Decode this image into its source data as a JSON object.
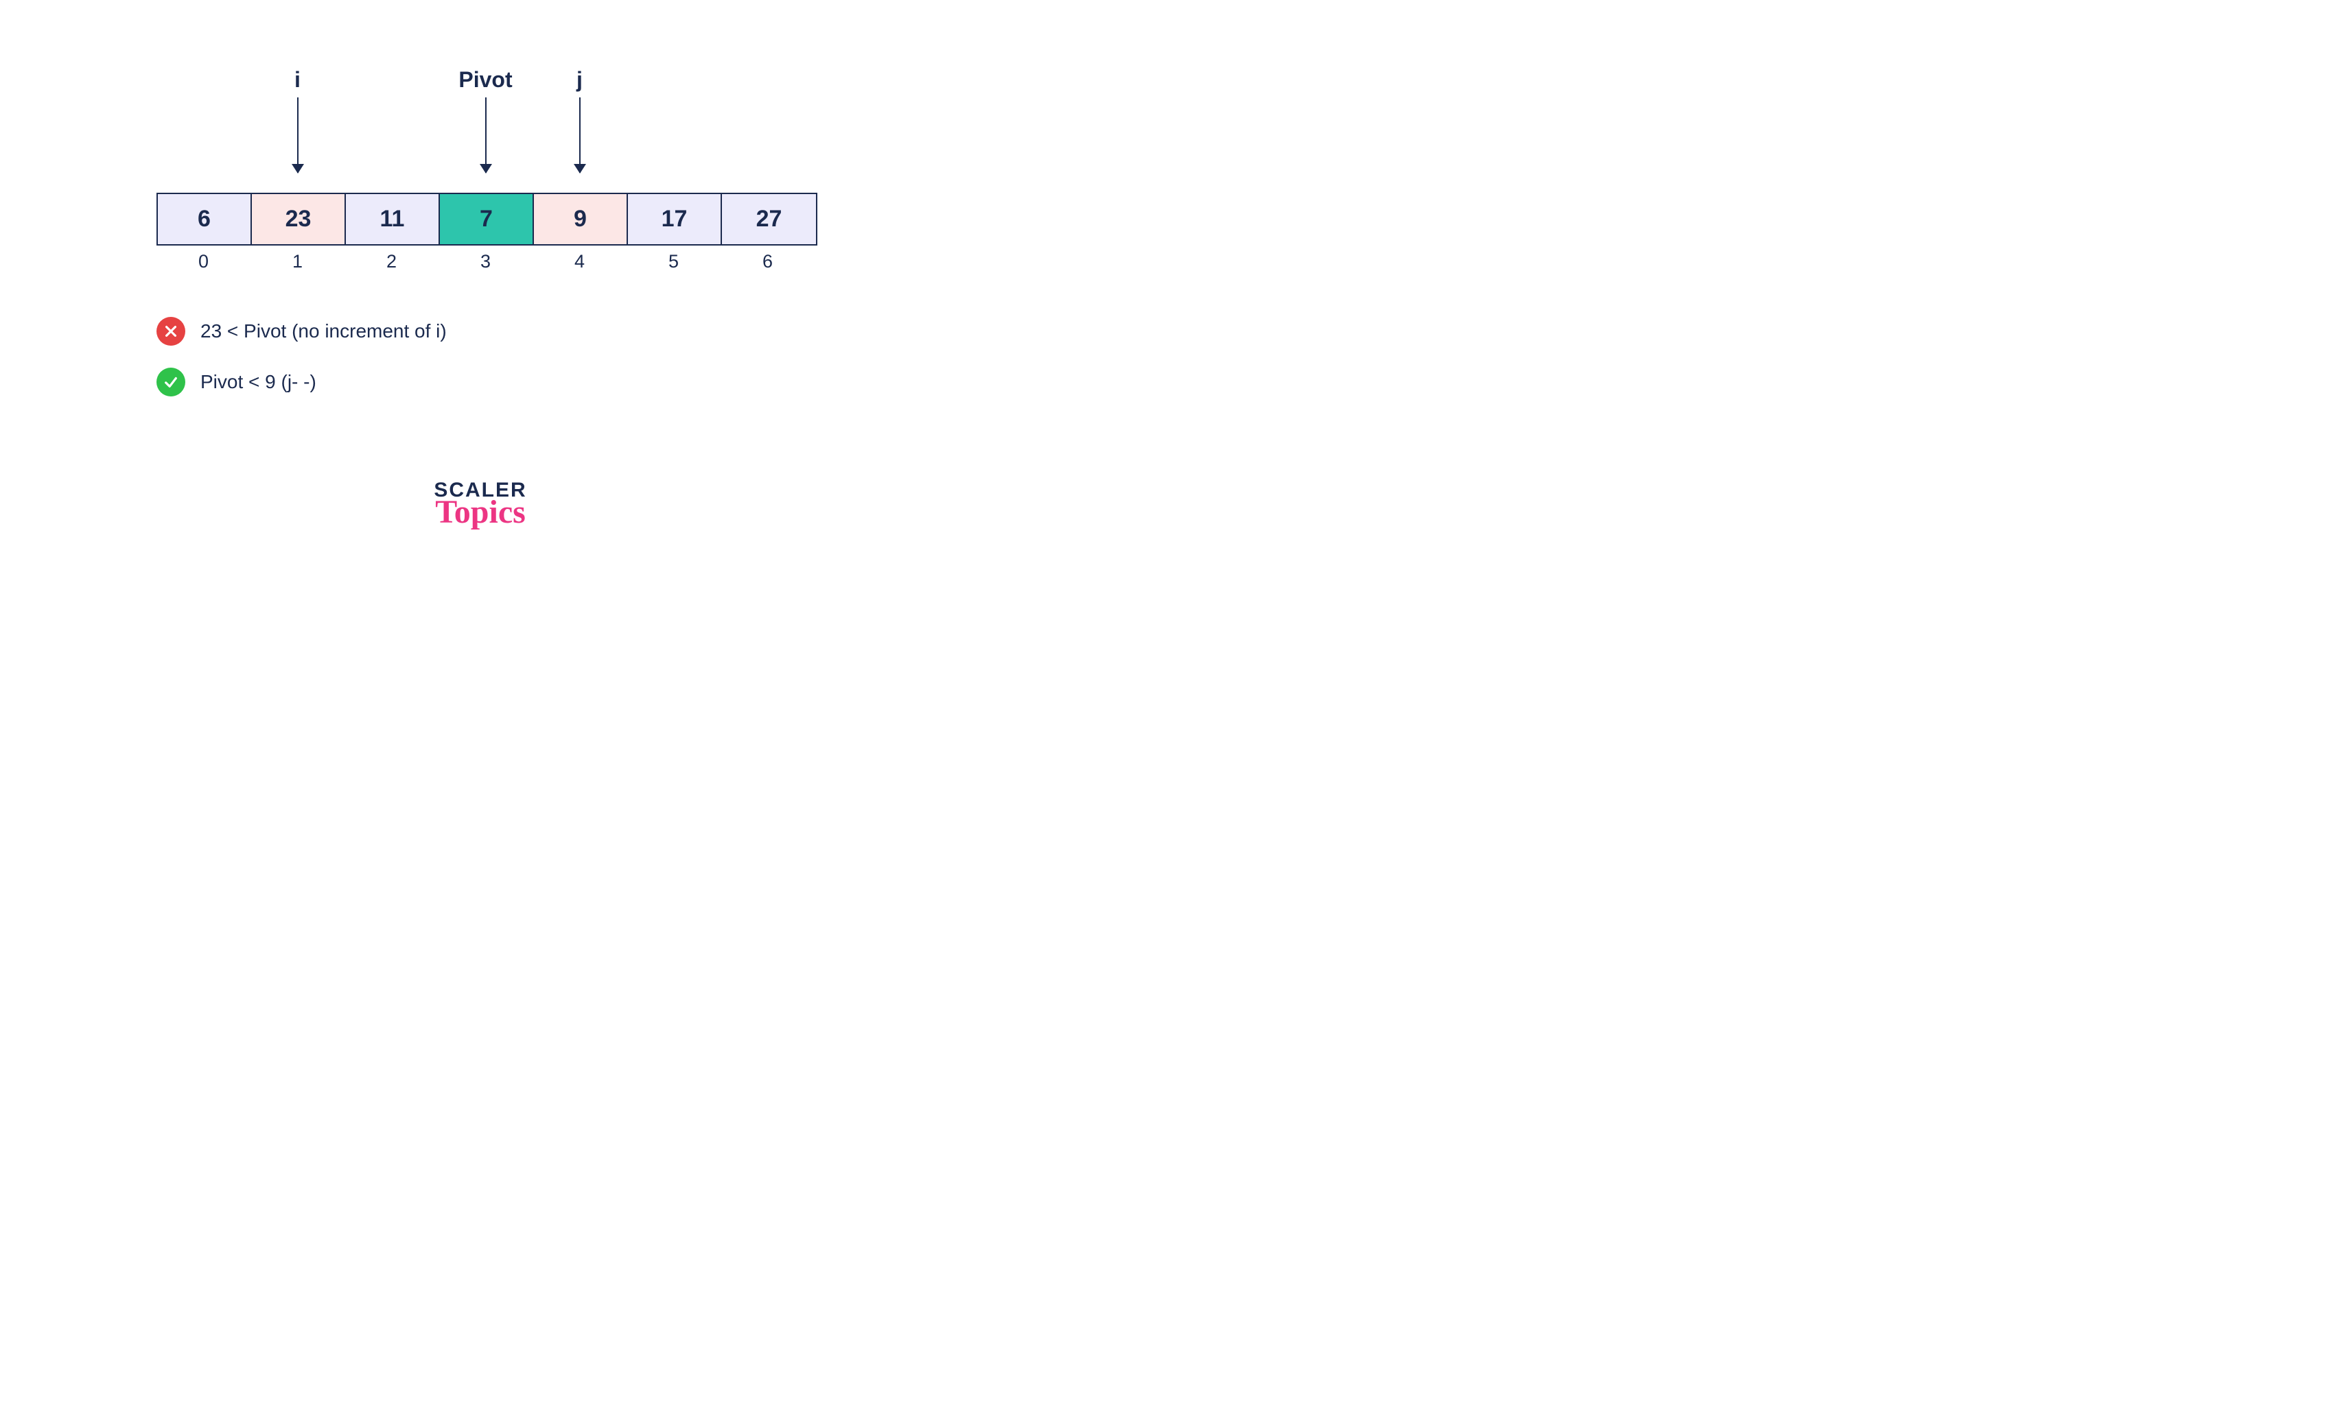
{
  "pointers": {
    "i": {
      "label": "i",
      "col": 1
    },
    "pivot": {
      "label": "Pivot",
      "col": 3
    },
    "j": {
      "label": "j",
      "col": 4
    }
  },
  "array": [
    {
      "value": "6",
      "state": "default",
      "index": "0"
    },
    {
      "value": "23",
      "state": "active",
      "index": "1"
    },
    {
      "value": "11",
      "state": "default",
      "index": "2"
    },
    {
      "value": "7",
      "state": "pivot",
      "index": "3"
    },
    {
      "value": "9",
      "state": "active",
      "index": "4"
    },
    {
      "value": "17",
      "state": "default",
      "index": "5"
    },
    {
      "value": "27",
      "state": "default",
      "index": "6"
    }
  ],
  "conditions": [
    {
      "ok": false,
      "text": "23 < Pivot (no increment of i)"
    },
    {
      "ok": true,
      "text": "Pivot < 9 (j- -)"
    }
  ],
  "brand": {
    "top": "SCALER",
    "bottom": "Topics"
  },
  "colors": {
    "default": "#ecebfb",
    "active": "#fce7e6",
    "pivot": "#2dc5ac",
    "fail": "#e64242",
    "pass": "#2fc24a"
  }
}
